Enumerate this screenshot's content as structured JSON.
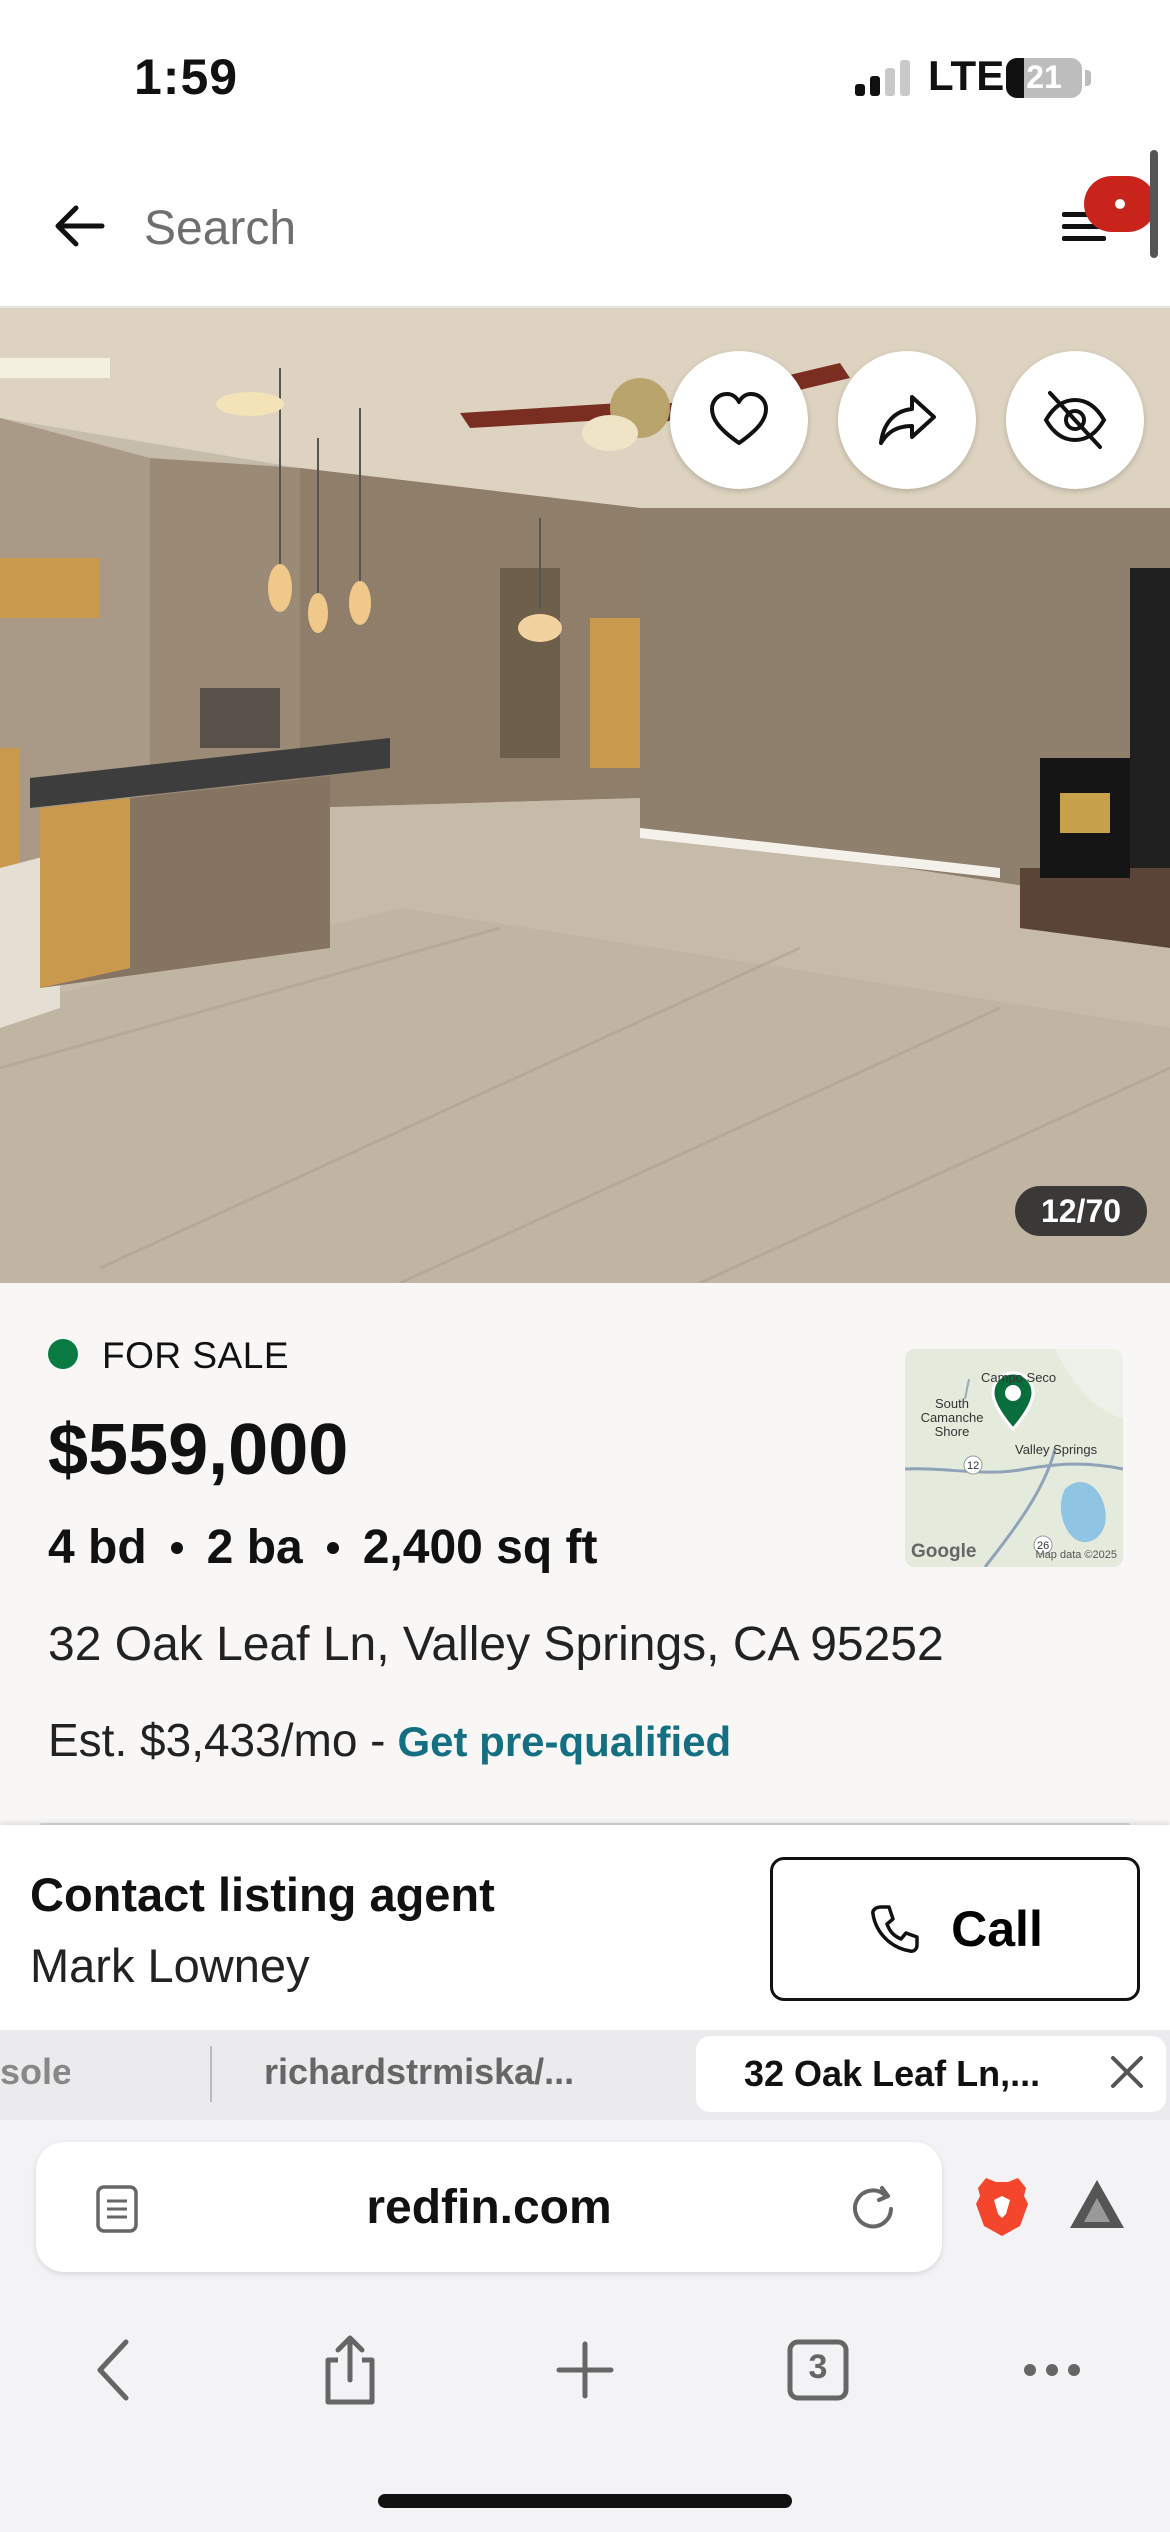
{
  "status_bar": {
    "time": "1:59",
    "network": "LTE",
    "battery_level": "21"
  },
  "search": {
    "placeholder": "Search"
  },
  "photo": {
    "counter": "12/70"
  },
  "listing": {
    "status": "FOR SALE",
    "status_color": "#0a7a43",
    "price": "$559,000",
    "beds": "4 bd",
    "baths": "2 ba",
    "sqft": "2,400 sq ft",
    "address": "32 Oak Leaf Ln, Valley Springs, CA 95252",
    "estimate": "Est. $3,433/mo -",
    "prequal_link": "Get pre-qualified",
    "link_color": "#146f82"
  },
  "map": {
    "labels": [
      "Campo Seco",
      "South Camanche Shore",
      "Valley Springs"
    ],
    "route_numbers": [
      "12",
      "26"
    ],
    "logo": "Google",
    "attribution": "Map data ©2025"
  },
  "contact": {
    "title": "Contact listing agent",
    "agent_name": "Mark Lowney",
    "call_label": "Call"
  },
  "browser": {
    "tabs": [
      {
        "label": "sole"
      },
      {
        "label": "richardstrmiska/..."
      },
      {
        "label": "32 Oak Leaf Ln,..."
      }
    ],
    "url": "redfin.com",
    "tab_count": "3"
  }
}
